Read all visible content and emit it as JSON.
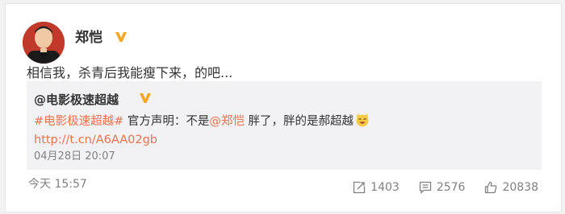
{
  "post": {
    "username": "郑恺",
    "text": "相信我，杀青后我能瘦下来，的吧...",
    "time": "今天 15:57"
  },
  "repost": {
    "author": "@电影极速超越",
    "hashtag": "#电影极速超越#",
    "text_part1": " 官方声明：不是",
    "mention": "@郑恺",
    "text_part2": " 胖了，胖的是郝超越",
    "url": "http://t.cn/A6AA02gb",
    "date": "04月28日 20:07"
  },
  "actions": {
    "repost_count": "1403",
    "comment_count": "2576",
    "like_count": "20838"
  },
  "colors": {
    "link": "#eb7350",
    "verified_badge": "#f5a623",
    "muted": "#808080"
  },
  "icons": [
    "verified-badge-icon",
    "laughing-cat-emoji-icon",
    "repost-icon",
    "comment-icon",
    "like-icon"
  ]
}
